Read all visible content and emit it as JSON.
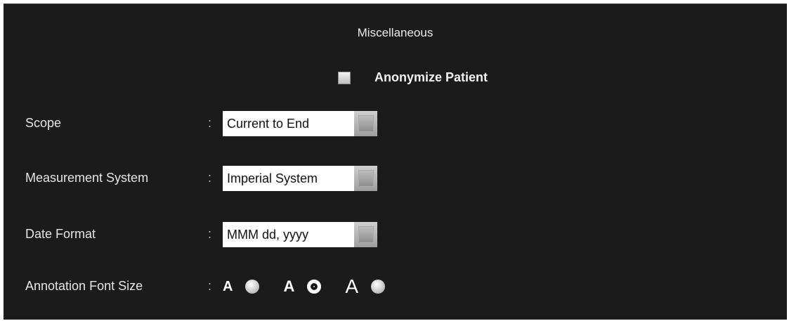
{
  "section": {
    "title": "Miscellaneous"
  },
  "anonymize": {
    "label": "Anonymize Patient",
    "checked": false
  },
  "separator": ":",
  "scope": {
    "label": "Scope",
    "value": "Current to End"
  },
  "measurement": {
    "label": "Measurement System",
    "value": "Imperial System"
  },
  "date_format": {
    "label": "Date Format",
    "value": "MMM dd, yyyy"
  },
  "annotation_font": {
    "label": "Annotation Font Size",
    "options": [
      {
        "letter": "A",
        "size": "small",
        "selected": false
      },
      {
        "letter": "A",
        "size": "medium",
        "selected": true
      },
      {
        "letter": "A",
        "size": "large",
        "selected": false
      }
    ]
  },
  "colors": {
    "panel_background": "#1b1b1b",
    "text": "#e6e6e6",
    "field_background": "#ffffff"
  }
}
